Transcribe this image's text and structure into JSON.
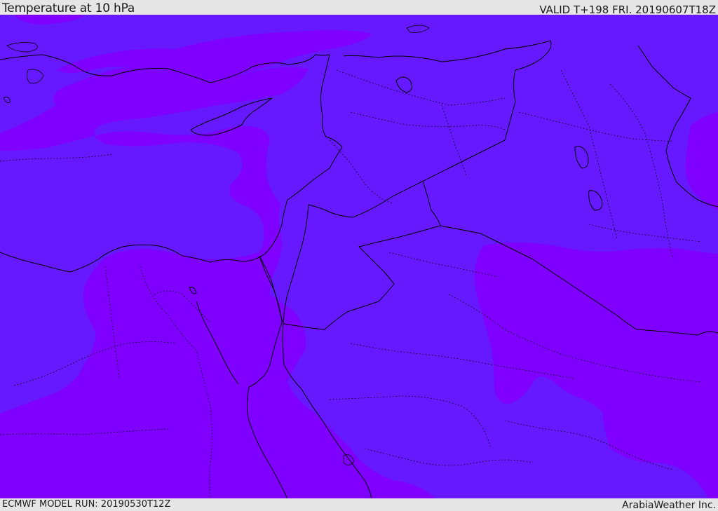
{
  "header": {
    "title": "Temperature at 10 hPa",
    "valid": "VALID T+198 FRI. 20190607T18Z"
  },
  "footer": {
    "model_run": "ECMWF MODEL RUN: 20190530T12Z",
    "credit": "ArabiaWeather Inc."
  },
  "map": {
    "field": "temperature",
    "level": "10 hPa",
    "colors": {
      "warmer_band": "#6619ff",
      "colder_band": "#7f00ff",
      "coastline": "#000000",
      "borders": "#000000"
    }
  }
}
